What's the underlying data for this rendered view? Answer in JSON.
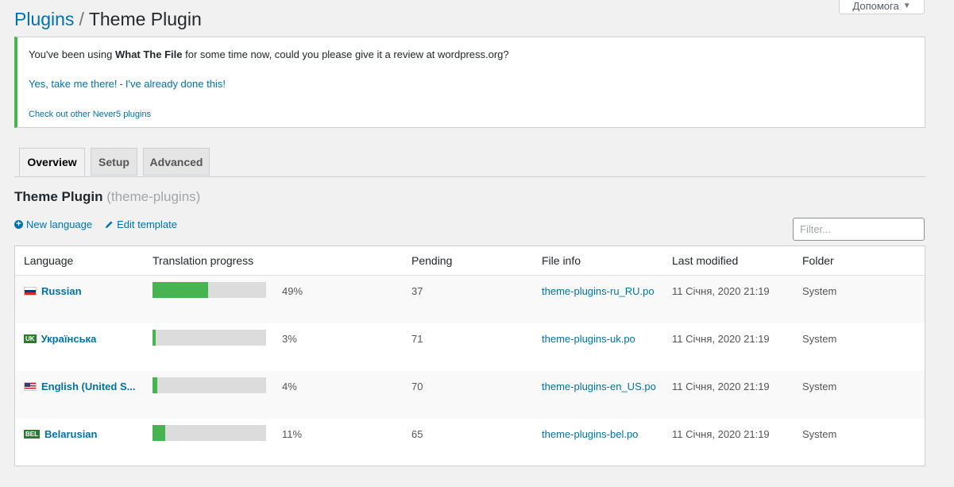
{
  "help_button": {
    "label": "Допомога",
    "caret": "▼"
  },
  "breadcrumb": {
    "parent": "Plugins",
    "separator": "/",
    "current": "Theme Plugin"
  },
  "notice": {
    "message_prefix": "You've been using ",
    "plugin_name": "What The File",
    "message_suffix": " for some time now, could you please give it a review at wordpress.org?",
    "action_primary": "Yes, take me there!",
    "action_separator": "-",
    "action_secondary": "I've already done this!",
    "other_link": "Check out other Never5 plugins",
    "accent_color": "#46b450"
  },
  "tabs": [
    {
      "label": "Overview",
      "active": true
    },
    {
      "label": "Setup",
      "active": false
    },
    {
      "label": "Advanced",
      "active": false
    }
  ],
  "section": {
    "title": "Theme Plugin",
    "slug": "(theme-plugins)"
  },
  "actions": {
    "new_language": "New language",
    "edit_template": "Edit template"
  },
  "filter": {
    "placeholder": "Filter...",
    "value": ""
  },
  "table": {
    "headers": {
      "language": "Language",
      "progress": "Translation progress",
      "pending": "Pending",
      "file": "File info",
      "modified": "Last modified",
      "folder": "Folder"
    },
    "rows": [
      {
        "flag": "ru",
        "flag_text": "",
        "language": "Russian",
        "progress": 0.49,
        "progress_label": "49%",
        "pending": "37",
        "file": "theme-plugins-ru_RU.po",
        "modified": "11 Січня, 2020 21:19",
        "folder": "System"
      },
      {
        "flag": "badge",
        "flag_text": "UK",
        "language": "Українська",
        "progress": 0.03,
        "progress_label": "3%",
        "pending": "71",
        "file": "theme-plugins-uk.po",
        "modified": "11 Січня, 2020 21:19",
        "folder": "System"
      },
      {
        "flag": "us",
        "flag_text": "",
        "language": "English (United S...",
        "progress": 0.04,
        "progress_label": "4%",
        "pending": "70",
        "file": "theme-plugins-en_US.po",
        "modified": "11 Січня, 2020 21:19",
        "folder": "System"
      },
      {
        "flag": "badge",
        "flag_text": "BEL",
        "language": "Belarusian",
        "progress": 0.11,
        "progress_label": "11%",
        "pending": "65",
        "file": "theme-plugins-bel.po",
        "modified": "11 Січня, 2020 21:19",
        "folder": "System"
      }
    ]
  },
  "colors": {
    "link": "#0073aa",
    "progress_fill": "#46b450",
    "progress_track": "#dcdcdc"
  }
}
